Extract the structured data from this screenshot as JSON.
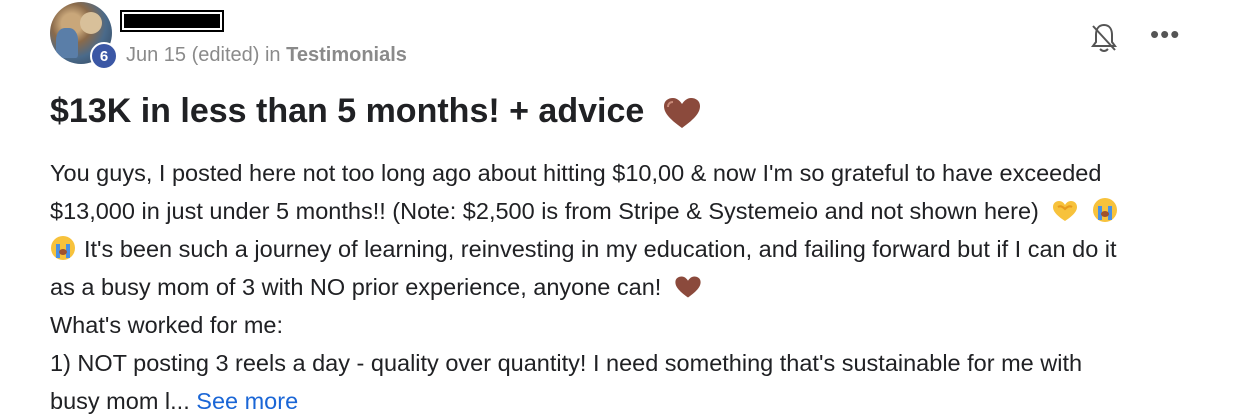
{
  "post": {
    "level": "6",
    "date": "Jun 15 (edited)",
    "in_label": "in",
    "category": "Testimonials",
    "title": "$13K in less than 5 months! + advice",
    "lines": [
      "You guys, I posted here not too long ago about hitting $10,00 & now I'm so grateful to have exceeded",
      "$13,000 in just under 5 months!! (Note: $2,500 is from Stripe & Systemeio and not shown here)",
      "It's been such a journey of learning, reinvesting in my education, and failing forward but if I can do it",
      "as a busy mom of 3 with NO prior experience, anyone can!",
      "What's worked for me:",
      "1) NOT posting 3 reels a day - quality over quantity! I need something that's sustainable for me with",
      "busy mom l..."
    ],
    "see_more": "See more"
  },
  "icons": {
    "bell": "bell-off-icon",
    "more": "more-options-icon",
    "heart": "brown-heart-emoji",
    "hands": "heart-hands-emoji",
    "crying": "crying-face-emoji"
  },
  "colors": {
    "badge": "#3b57a5",
    "link": "#1a66d6",
    "meta": "#8a8a8a",
    "heart": "#8b4a3c"
  }
}
